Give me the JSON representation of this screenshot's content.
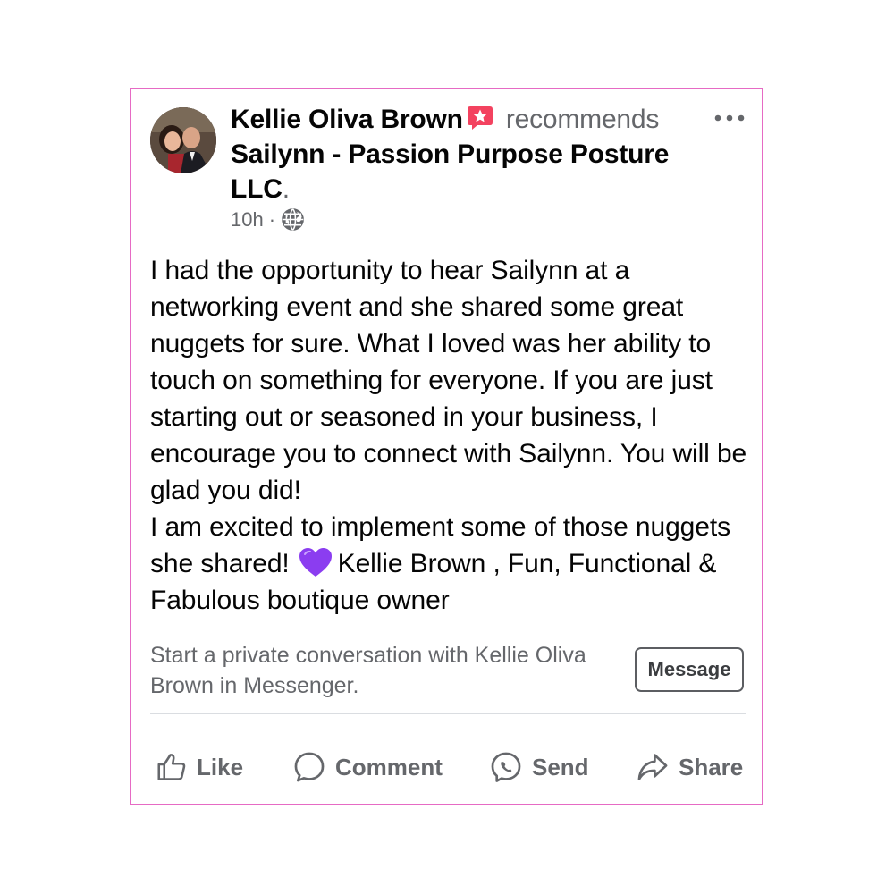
{
  "post": {
    "author": "Kellie Oliva Brown",
    "verb": "recommends",
    "page_name": "Sailynn - Passion Purpose Posture LLC",
    "period": ".",
    "time": "10h",
    "separator": "·",
    "audience_icon": "globe-icon",
    "recommend_icon": "star-badge-icon",
    "body_paragraph_1": "I had the opportunity to hear Sailynn at a networking event and she shared some great nuggets for sure. What I loved was her ability to touch on something for everyone. If you are just starting out or seasoned in your business, I encourage you to connect with Sailynn. You will be glad you did!",
    "body_paragraph_2_start": "I am excited to implement some of those nuggets she shared!",
    "body_paragraph_2_end": "Kellie Brown , Fun, Functional & Fabulous boutique owner",
    "emoji": "purple-heart"
  },
  "messenger": {
    "prompt": "Start a private conversation with Kellie Oliva Brown in Messenger.",
    "button_label": "Message"
  },
  "actions": [
    {
      "label": "Like",
      "icon": "thumbs-up-icon"
    },
    {
      "label": "Comment",
      "icon": "comment-icon"
    },
    {
      "label": "Send",
      "icon": "messenger-icon"
    },
    {
      "label": "Share",
      "icon": "share-icon"
    }
  ],
  "colors": {
    "card_border": "#e66ac4",
    "secondary_text": "#65676b",
    "primary_text": "#050505",
    "badge": "#f3425f",
    "heart": "#8b3df0"
  }
}
